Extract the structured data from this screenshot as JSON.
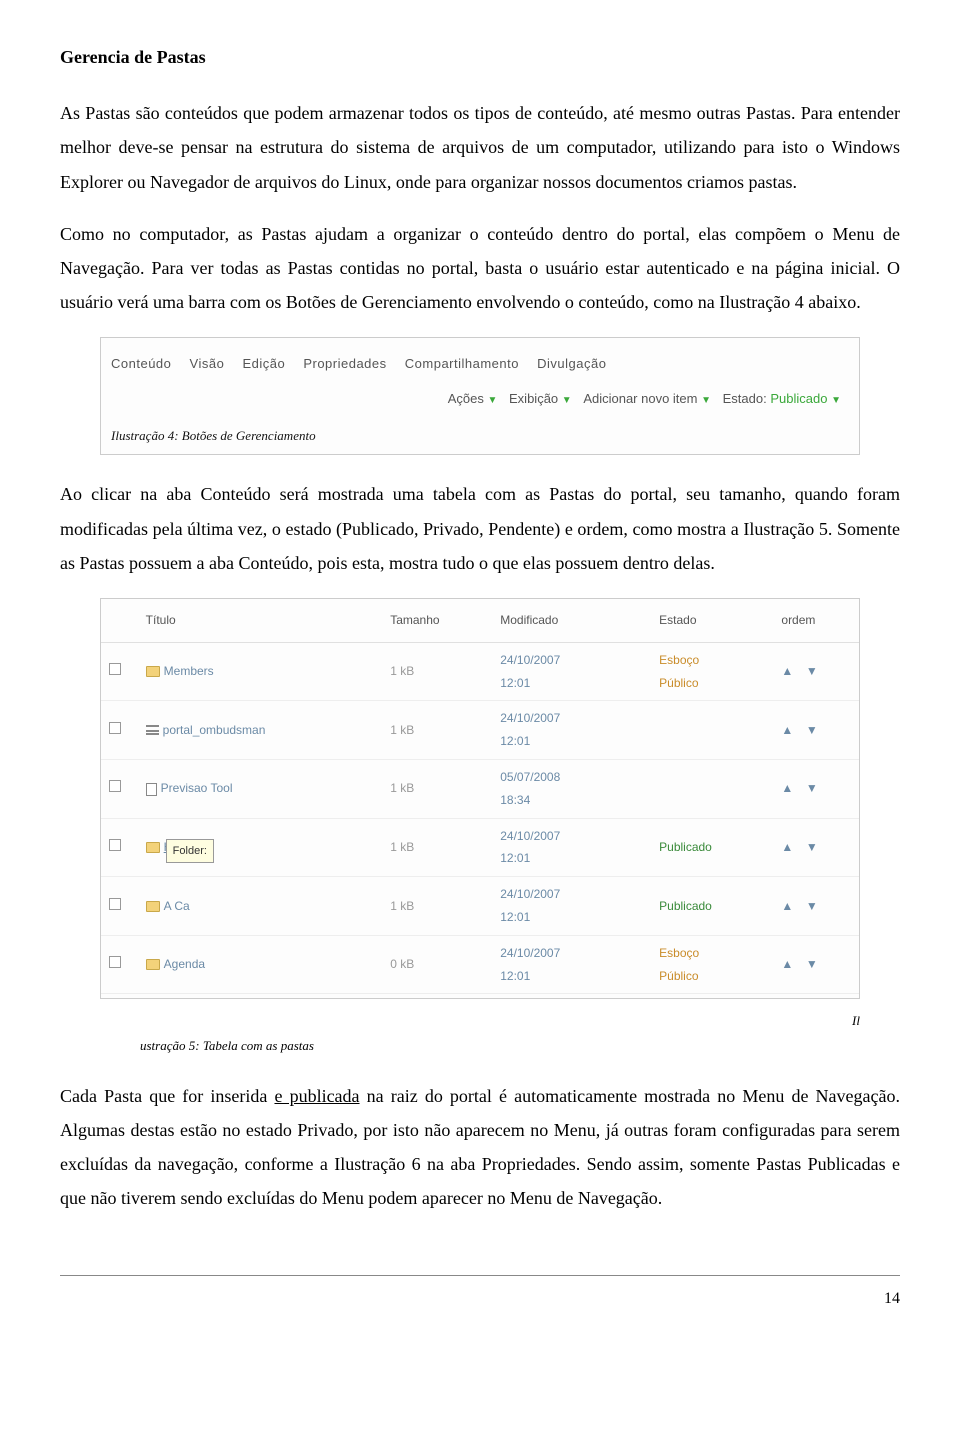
{
  "heading": "Gerencia de Pastas",
  "p1": "As Pastas são conteúdos que podem armazenar todos os tipos de conteúdo, até mesmo outras Pastas. Para entender melhor deve-se pensar na estrutura do sistema de arquivos de um computador, utilizando para isto o Windows Explorer ou Navegador de arquivos do Linux, onde para organizar nossos documentos criamos pastas.",
  "p2": "Como no computador, as Pastas ajudam a organizar o conteúdo dentro do portal, elas compõem o Menu de Navegação. Para ver todas as Pastas contidas no portal, basta o usuário estar autenticado e na página inicial. O usuário verá uma barra com os Botões de Gerenciamento envolvendo o conteúdo, como na Ilustração 4 abaixo.",
  "toolbar": {
    "tabs": [
      "Conteúdo",
      "Visão",
      "Edição",
      "Propriedades",
      "Compartilhamento",
      "Divulgação"
    ],
    "actions": [
      "Ações",
      "Exibição",
      "Adicionar novo item"
    ],
    "state_label": "Estado:",
    "state_value": "Publicado",
    "caption": "Ilustração 4: Botões de Gerenciamento"
  },
  "p3": "Ao clicar na aba Conteúdo será mostrada uma tabela com as Pastas do portal, seu tamanho, quando foram modificadas pela última vez, o estado (Publicado, Privado, Pendente) e ordem, como mostra a Ilustração 5. Somente as Pastas possuem a aba Conteúdo, pois esta, mostra tudo o que elas possuem dentro delas.",
  "table": {
    "headers": [
      "",
      "Título",
      "Tamanho",
      "Modificado",
      "Estado",
      "ordem"
    ],
    "rows": [
      {
        "icon": "folder",
        "title": "Members",
        "size": "1 kB",
        "modified": "24/10/2007 12:01",
        "state": "Esboço Público",
        "state_class": "state-esboço"
      },
      {
        "icon": "lines",
        "title": "portal_ombudsman",
        "size": "1 kB",
        "modified": "24/10/2007 12:01",
        "state": "",
        "state_class": "black"
      },
      {
        "icon": "page",
        "title": "Previsao Tool",
        "size": "1 kB",
        "modified": "05/07/2008 18:34",
        "state": "",
        "state_class": "black"
      },
      {
        "icon": "folder",
        "title": "História",
        "size": "1 kB",
        "modified": "24/10/2007 12:01",
        "state": "Publicado",
        "state_class": "state-publicado",
        "tooltip": "Folder:"
      },
      {
        "icon": "folder",
        "title": "A Ca",
        "size": "1 kB",
        "modified": "24/10/2007 12:01",
        "state": "Publicado",
        "state_class": "state-publicado"
      },
      {
        "icon": "folder",
        "title": "Agenda",
        "size": "0 kB",
        "modified": "24/10/2007 12:01",
        "state": "Esboço Público",
        "state_class": "state-esboço"
      }
    ],
    "il_frag": "Il",
    "caption2": "ustração 5: Tabela com as pastas"
  },
  "p4_a": "Cada Pasta que for inserida ",
  "p4_u": "e publicada",
  "p4_b": " na raiz do portal é automaticamente mostrada no Menu de Navegação. Algumas destas estão no estado Privado, por isto não aparecem no Menu, já outras foram configuradas para serem excluídas da navegação, conforme a Ilustração 6 na aba Propriedades. Sendo assim, somente Pastas Publicadas e que não tiverem sendo excluídas do Menu podem aparecer no Menu de Navegação.",
  "page_num": "14"
}
